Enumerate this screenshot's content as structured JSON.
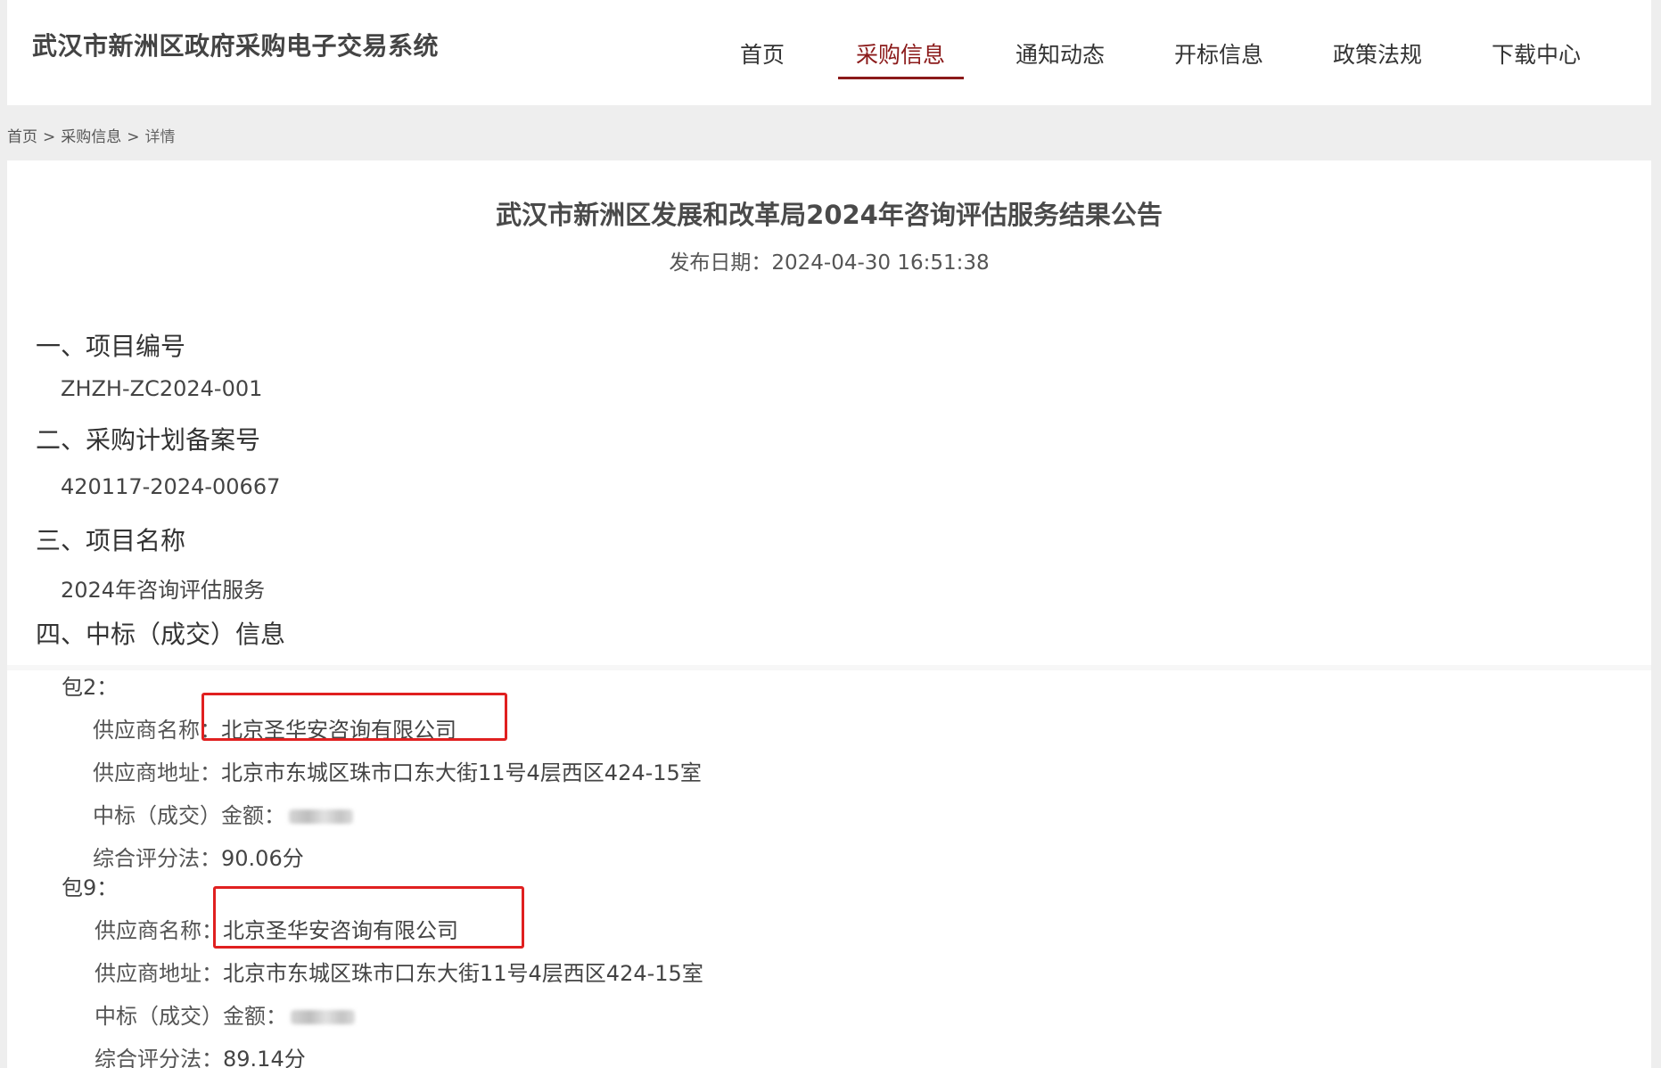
{
  "header": {
    "site_title": "武汉市新洲区政府采购电子交易系统",
    "nav": [
      {
        "label": "首页",
        "active": false
      },
      {
        "label": "采购信息",
        "active": true
      },
      {
        "label": "通知动态",
        "active": false
      },
      {
        "label": "开标信息",
        "active": false
      },
      {
        "label": "政策法规",
        "active": false
      },
      {
        "label": "下载中心",
        "active": false
      }
    ],
    "accent_color": "#8b1a1a"
  },
  "breadcrumb": {
    "items": [
      "首页",
      "采购信息",
      "详情"
    ],
    "separator": ">"
  },
  "article": {
    "title": "武汉市新洲区发展和改革局2024年咨询评估服务结果公告",
    "publish_date_label": "发布日期：",
    "publish_date": "2024-04-30 16:51:38",
    "sections": [
      {
        "heading": "一、项目编号",
        "value": "ZHZH-ZC2024-001"
      },
      {
        "heading": "二、采购计划备案号",
        "value": "420117-2024-00667"
      },
      {
        "heading": "三、项目名称",
        "value": "2024年咨询评估服务"
      },
      {
        "heading": "四、中标（成交）信息"
      }
    ],
    "labels": {
      "supplier_name": "供应商名称：",
      "supplier_address": "供应商地址：",
      "amount": "中标（成交）金额：",
      "score": "综合评分法："
    },
    "packages": [
      {
        "label": "包2：",
        "supplier_name": "北京圣华安咨询有限公司",
        "supplier_address": "北京市东城区珠市口东大街11号4层西区424-15室",
        "score": "90.06分"
      },
      {
        "label": "包9：",
        "supplier_name": "北京圣华安咨询有限公司",
        "supplier_address": "北京市东城区珠市口东大街11号4层西区424-15室",
        "score": "89.14分"
      }
    ],
    "highlight_color": "#e02020"
  }
}
